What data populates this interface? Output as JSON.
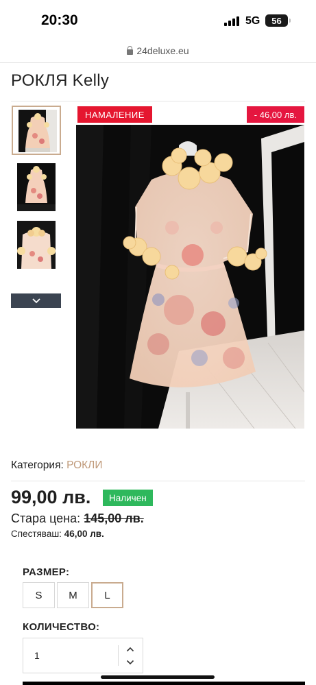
{
  "status_bar": {
    "time": "20:30",
    "network": "5G",
    "battery": "56"
  },
  "browser": {
    "url": "24deluxe.eu"
  },
  "product": {
    "title": "РОКЛЯ Kelly",
    "badge_sale": "НАМАЛЕНИЕ",
    "badge_discount": "- 46,00 лв.",
    "category_label": "Категория:",
    "category_value": "РОКЛИ",
    "price": "99,00 лв.",
    "stock": "Наличен",
    "old_price_label": "Стара цена:",
    "old_price": "145,00 лв.",
    "save_label": "Спестяваш:",
    "save_value": "46,00 лв."
  },
  "size": {
    "label": "РАЗМЕР:",
    "options": [
      "S",
      "M",
      "L"
    ],
    "selected": "L"
  },
  "quantity": {
    "label": "КОЛИЧЕСТВО:",
    "value": "1"
  },
  "colors": {
    "accent": "#c9ab8f",
    "sale_badge": "#e5162f",
    "stock_badge": "#2eb85c",
    "thumb_nav": "#3b4451"
  },
  "icons": [
    "lock-icon",
    "chevron-down-icon",
    "chevron-up-icon"
  ]
}
